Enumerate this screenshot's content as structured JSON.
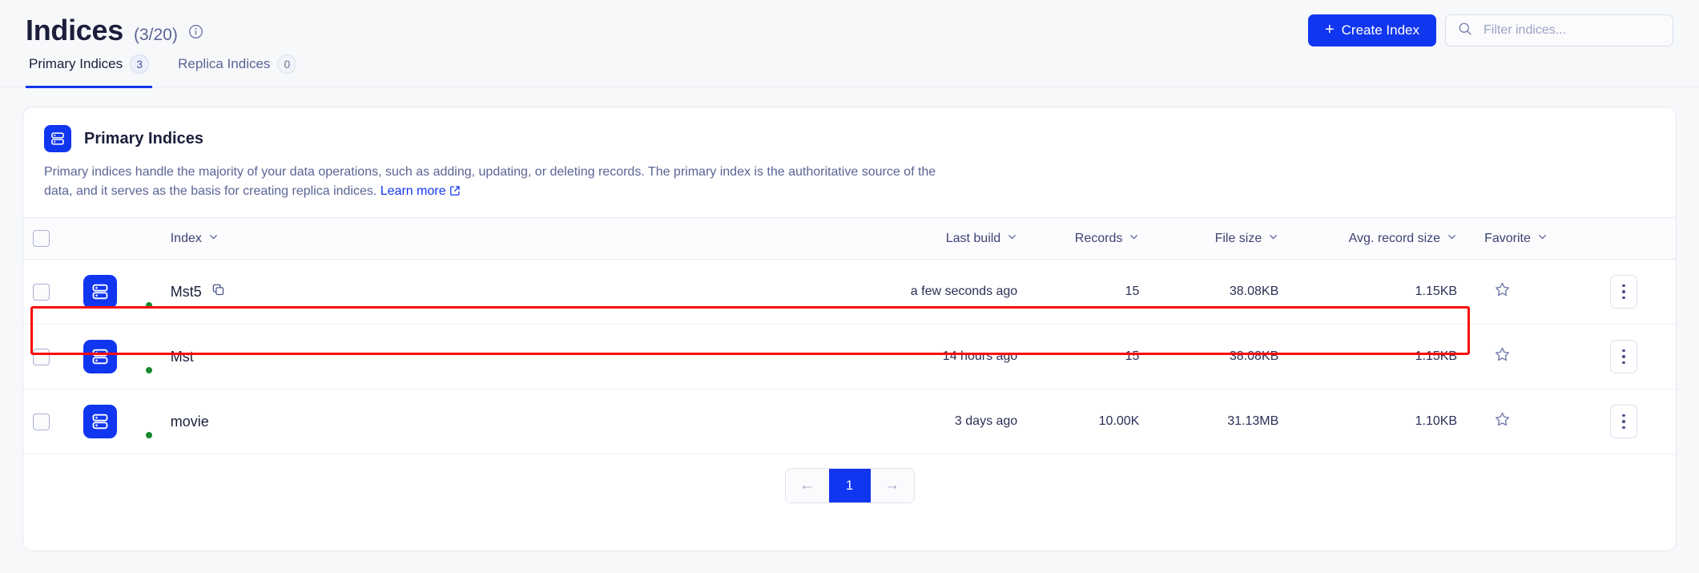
{
  "header": {
    "title": "Indices",
    "count": "(3/20)",
    "info_icon": "info-circle-icon",
    "create_button": {
      "label": "Create Index",
      "plus": "+",
      "color": "#1136ef"
    },
    "search": {
      "placeholder": "Filter indices...",
      "value": "",
      "icon": "search-icon"
    }
  },
  "tabs": [
    {
      "label": "Primary Indices",
      "badge": "3",
      "active": true
    },
    {
      "label": "Replica Indices",
      "badge": "0",
      "active": false
    }
  ],
  "card": {
    "icon": "database-index-icon",
    "title": "Primary Indices",
    "description": "Primary indices handle the majority of your data operations, such as adding, updating, or deleting records. The primary index is the authoritative source of the data, and it serves as the basis for creating replica indices.",
    "learn_more": "Learn more",
    "learn_more_icon": "external-link-icon"
  },
  "table": {
    "select_all_icon": "checkbox-unchecked-icon",
    "sort_icon": "chevron-down-icon",
    "columns": [
      {
        "key": "index",
        "label": "Index",
        "sortable": true
      },
      {
        "key": "last_build",
        "label": "Last build",
        "sortable": true
      },
      {
        "key": "records",
        "label": "Records",
        "sortable": true
      },
      {
        "key": "file_size",
        "label": "File size",
        "sortable": true
      },
      {
        "key": "avg_record_size",
        "label": "Avg. record size",
        "sortable": true
      },
      {
        "key": "favorite",
        "label": "Favorite",
        "sortable": true
      }
    ],
    "rows": [
      {
        "name": "Mst5",
        "status": "online",
        "has_copy_icon": true,
        "last_build": "a few seconds ago",
        "records": "15",
        "file_size": "38.08KB",
        "avg_record_size": "1.15KB",
        "favorite_icon": "star-outline-icon",
        "menu_icon": "kebab-menu-icon",
        "highlighted": true
      },
      {
        "name": "Mst",
        "status": "online",
        "has_copy_icon": false,
        "last_build": "14 hours ago",
        "records": "15",
        "file_size": "38.08KB",
        "avg_record_size": "1.15KB",
        "favorite_icon": "star-outline-icon",
        "menu_icon": "kebab-menu-icon",
        "highlighted": false
      },
      {
        "name": "movie",
        "status": "online",
        "has_copy_icon": false,
        "last_build": "3 days ago",
        "records": "10.00K",
        "file_size": "31.13MB",
        "avg_record_size": "1.10KB",
        "favorite_icon": "star-outline-icon",
        "menu_icon": "kebab-menu-icon",
        "highlighted": false
      }
    ]
  },
  "pagination": {
    "prev": "←",
    "next": "→",
    "current_page": "1"
  },
  "annotation": {
    "highlight_color": "#fb0b0b"
  }
}
